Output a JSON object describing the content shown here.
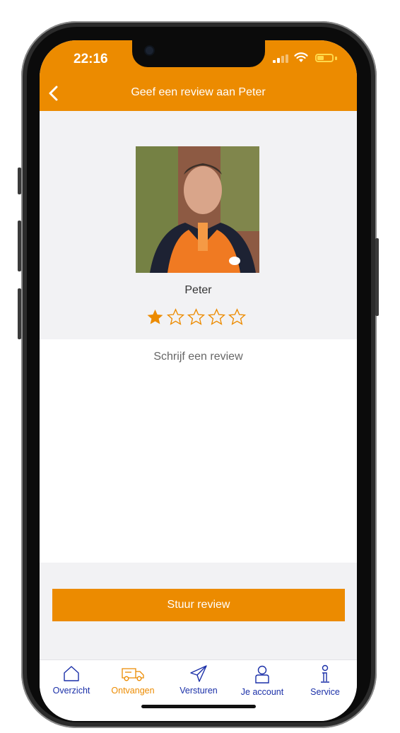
{
  "status_bar": {
    "time": "22:16"
  },
  "header": {
    "title": "Geef een review aan Peter"
  },
  "profile": {
    "name": "Peter",
    "rating": 1,
    "max_rating": 5
  },
  "review": {
    "placeholder": "Schrijf een review"
  },
  "submit_label": "Stuur review",
  "colors": {
    "brand_orange": "#ec8b00",
    "tab_blue": "#1a2fa8",
    "active_tab": "#ec8b00"
  },
  "tabs": [
    {
      "label": "Overzicht",
      "icon": "home-icon",
      "active": false
    },
    {
      "label": "Ontvangen",
      "icon": "delivery-van-icon",
      "active": true
    },
    {
      "label": "Versturen",
      "icon": "send-icon",
      "active": false
    },
    {
      "label": "Je account",
      "icon": "user-icon",
      "active": false
    },
    {
      "label": "Service",
      "icon": "info-icon",
      "active": false
    }
  ]
}
